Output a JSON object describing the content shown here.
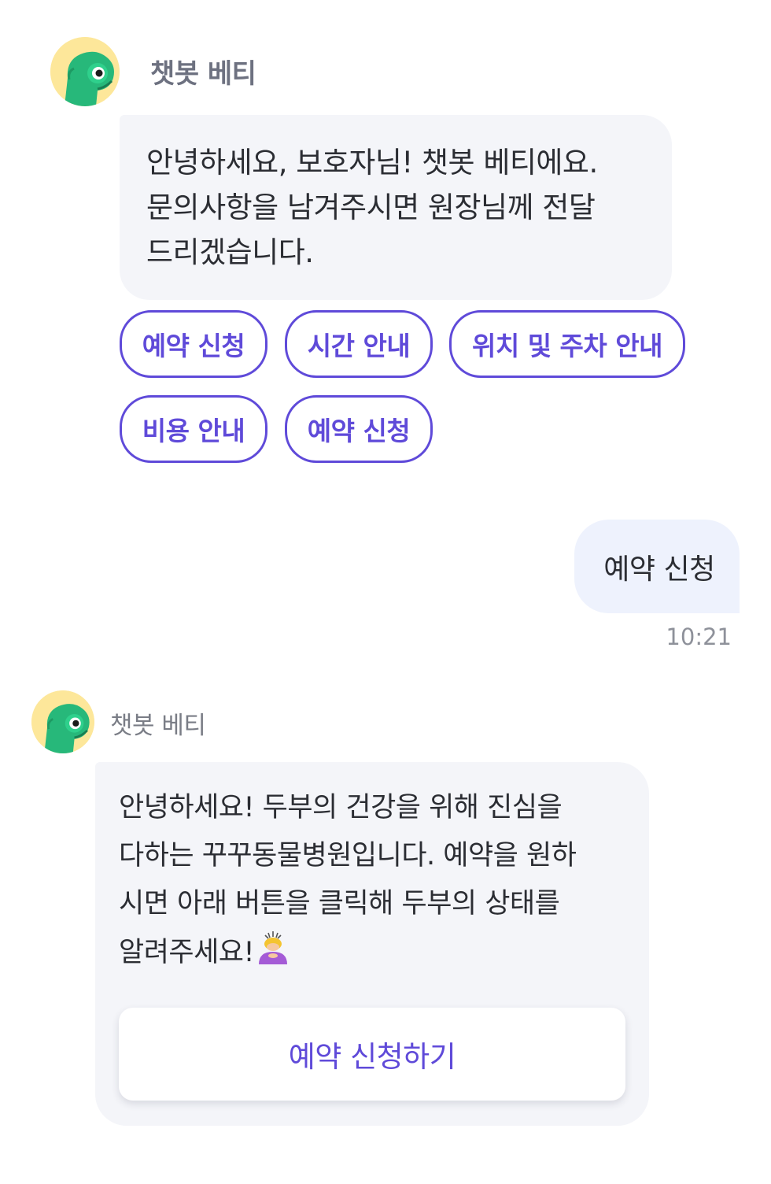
{
  "colors": {
    "accent": "#5f4ad9",
    "bubble_bot": "#f4f5f9",
    "bubble_user": "#eef2fd",
    "avatar_bg": "#fde79a",
    "mascot_green": "#27b87a"
  },
  "first_message": {
    "avatar_icon": "chameleon-mascot-icon",
    "bot_name": "챗봇 베티",
    "lines": [
      "안녕하세요, 보호자님! 챗봇 베티에요.",
      "문의사항을 남겨주시면 원장님께 전달",
      "드리겠습니다."
    ],
    "quick_replies": [
      "예약 신청",
      "시간 안내",
      "위치 및 주차 안내",
      "비용 안내",
      "예약 신청"
    ]
  },
  "user_message": {
    "text": "예약 신청",
    "time": "10:21"
  },
  "second_message": {
    "avatar_icon": "chameleon-mascot-icon",
    "bot_name": "챗봇 베티",
    "lines": [
      "안녕하세요! 두부의 건강을 위해 진심을",
      "다하는 꾸꾸동물병원입니다. 예약을 원하",
      "시면 아래 버튼을 클릭해 두부의 상태를",
      "알려주세요!"
    ],
    "emoji_icon": "bowing-woman-emoji-icon",
    "button_label": "예약 신청하기"
  }
}
